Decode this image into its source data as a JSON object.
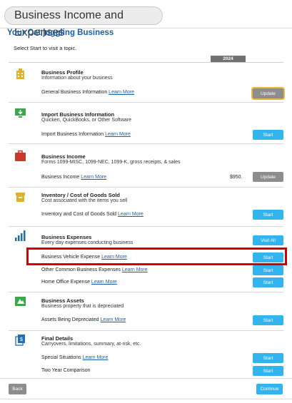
{
  "header": {
    "tab_title": "Business Income and Expenses"
  },
  "business_name": "Your Cat juggling Business",
  "instructions": "Select Start to visit a topic.",
  "year": "2024",
  "sections": {
    "profile": {
      "title": "Business Profile",
      "description": "Information about your business",
      "row": {
        "label": "General Business Information",
        "link": "Learn More",
        "button": "Update"
      }
    },
    "import": {
      "title": "Import Business Information",
      "description": "Quicken, QuickBooks, or Other Software",
      "row": {
        "label": "Import Business Information",
        "link": "Learn More",
        "button": "Start"
      }
    },
    "income": {
      "title": "Business Income",
      "description": "Forms 1099-MISC, 1099-NEC, 1099-K, gross receipts, & sales",
      "row": {
        "label": "Business Income",
        "link": "Learn More",
        "amount": "$950.",
        "button": "Update"
      }
    },
    "inventory": {
      "title": "Inventory / Cost of Goods Sold",
      "description": "Cost associated with the items you sell",
      "row": {
        "label": "Inventory and Cost of Goods Sold",
        "link": "Learn More",
        "button": "Start"
      }
    },
    "expenses": {
      "title": "Business Expenses",
      "description": "Every day expenses conducting business",
      "visit_all": "Visit All",
      "rows": [
        {
          "label": "Business Vehicle Expense",
          "link": "Learn More",
          "button": "Start"
        },
        {
          "label": "Other Common Business Expenses",
          "link": "Learn More",
          "button": "Start"
        },
        {
          "label": "Home Office Expense",
          "link": "Learn More",
          "button": "Start"
        }
      ]
    },
    "assets": {
      "title": "Business Assets",
      "description": "Business property that is depreciated",
      "row": {
        "label": "Assets Being Depreciated",
        "link": "Learn More",
        "button": "Start"
      }
    },
    "final": {
      "title": "Final Details",
      "description": "Carryovers, limitations, summary, at-risk, etc.",
      "rows": [
        {
          "label": "Special Situations",
          "link": "Learn More",
          "button": "Start"
        },
        {
          "label": "Two Year Comparison",
          "button": "Start"
        }
      ]
    }
  },
  "footer": {
    "back": "Back",
    "continue": "Continue"
  },
  "colors": {
    "accent": "#32b4ef",
    "link": "#1a5ea8",
    "icon_gold": "#e0b12c",
    "icon_green": "#3aa84a",
    "icon_red": "#c9392b",
    "icon_blue": "#1e6fb8",
    "highlight": "#d40000"
  }
}
